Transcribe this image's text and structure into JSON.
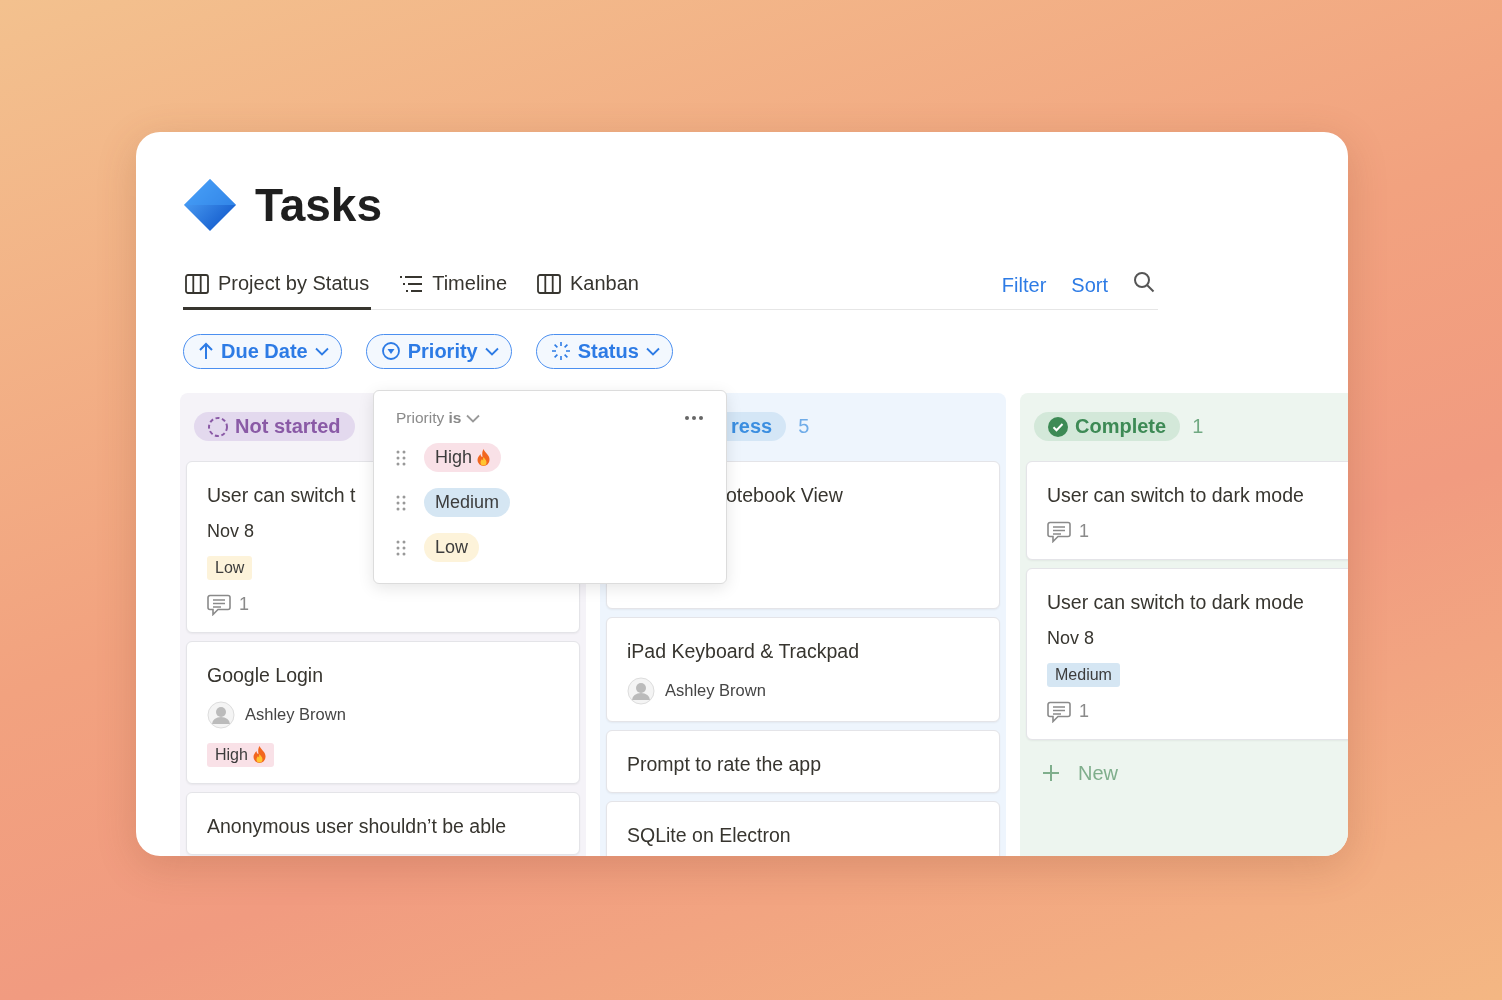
{
  "page": {
    "title": "Tasks"
  },
  "views": [
    {
      "label": "Project by Status",
      "kind": "board",
      "selected": true
    },
    {
      "label": "Timeline",
      "kind": "timeline",
      "selected": false
    },
    {
      "label": "Kanban",
      "kind": "board",
      "selected": false
    }
  ],
  "view_actions": [
    {
      "label": "Filter"
    },
    {
      "label": "Sort"
    }
  ],
  "grouping_chips": [
    {
      "label": "Due Date",
      "kind": "date"
    },
    {
      "label": "Priority",
      "kind": "priority"
    },
    {
      "label": "Status",
      "kind": "status"
    }
  ],
  "columns": [
    {
      "kind": "not-started",
      "status": "Not started",
      "cards": [
        {
          "title": "User can switch t",
          "date": "Nov 8",
          "priority": {
            "label": "Low",
            "kind": "low"
          },
          "comments": "1"
        },
        {
          "title": "Google Login",
          "assignee": "Ashley Brown",
          "priority": {
            "label": "High",
            "kind": "high"
          }
        },
        {
          "title": "Anonymous user shouldn’t be able"
        }
      ]
    },
    {
      "kind": "in-progress",
      "status": "ress",
      "count": "5",
      "cards": [
        {
          "title": "otebook View"
        },
        {
          "title": "iPad Keyboard & Trackpad",
          "assignee": "Ashley Brown"
        },
        {
          "title": "Prompt to rate the app"
        },
        {
          "title": "SQLite on Electron"
        }
      ]
    },
    {
      "kind": "complete",
      "status": "Complete",
      "count": "1",
      "footer": "New",
      "cards": [
        {
          "title": "User can switch to dark mode",
          "comments": "1"
        },
        {
          "title": "User can switch to dark mode",
          "date": "Nov 8",
          "priority": {
            "label": "Medium",
            "kind": "medium"
          },
          "comments": "1"
        }
      ]
    }
  ],
  "priority_menu": {
    "heading": "Priority **is**",
    "options": [
      {
        "label": "High",
        "kind": "high"
      },
      {
        "label": "Medium",
        "kind": "medium"
      },
      {
        "label": "Low",
        "kind": "low"
      }
    ]
  }
}
